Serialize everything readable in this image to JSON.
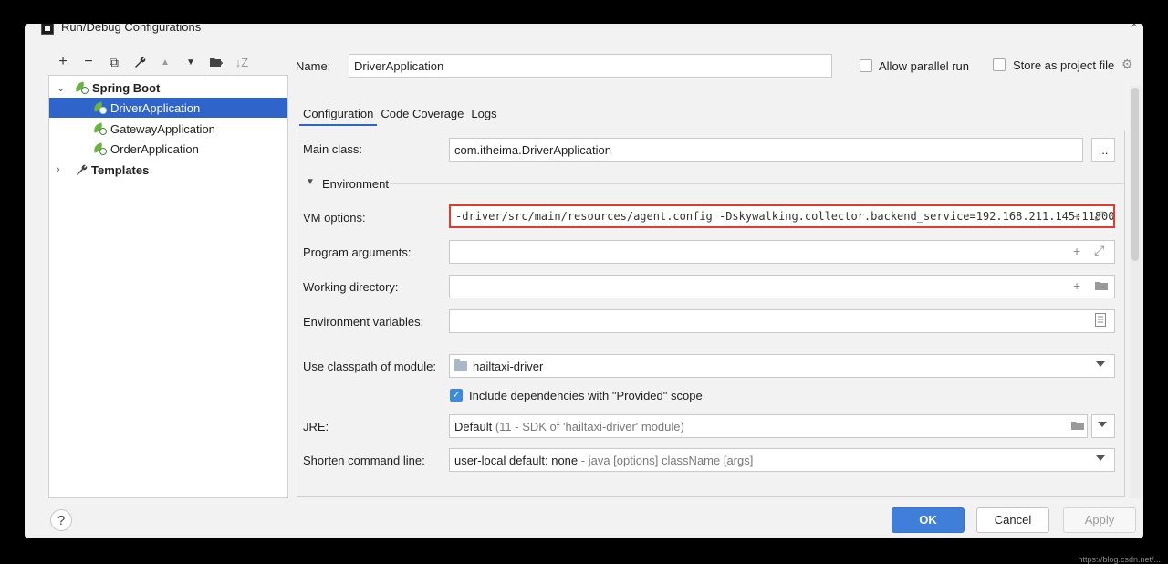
{
  "window": {
    "title": "Run/Debug Configurations",
    "close": "×"
  },
  "toolbar": {
    "add": "+",
    "remove": "−",
    "copy": "⧉",
    "edit": "🔧",
    "up": "▲",
    "down": "▼",
    "folder": "▸",
    "sort": "⇅"
  },
  "tree": {
    "spring_boot": "Spring Boot",
    "items": [
      "DriverApplication",
      "GatewayApplication",
      "OrderApplication"
    ],
    "templates": "Templates"
  },
  "name_row": {
    "label": "Name:",
    "value": "DriverApplication",
    "allow_parallel": "Allow parallel run",
    "store_project": "Store as project file"
  },
  "tabs": [
    "Configuration",
    "Code Coverage",
    "Logs"
  ],
  "form": {
    "main_class_label": "Main class:",
    "main_class_value": "com.itheima.DriverApplication",
    "browse": "...",
    "environment": "Environment",
    "vm_options_label": "VM options:",
    "vm_options_value": "-driver/src/main/resources/agent.config -Dskywalking.collector.backend_service=192.168.211.145:11800",
    "program_args_label": "Program arguments:",
    "working_dir_label": "Working directory:",
    "env_vars_label": "Environment variables:",
    "classpath_label": "Use classpath of module:",
    "classpath_value": "hailtaxi-driver",
    "include_deps": "Include dependencies with \"Provided\" scope",
    "jre_label": "JRE:",
    "jre_value": "Default",
    "jre_hint": "(11 - SDK of 'hailtaxi-driver' module)",
    "shorten_label": "Shorten command line:",
    "shorten_value": "user-local default: none",
    "shorten_hint": "- java [options] className [args]"
  },
  "buttons": {
    "help": "?",
    "ok": "OK",
    "cancel": "Cancel",
    "apply": "Apply"
  },
  "watermark": "https://blog.csdn.net/...",
  "colors": {
    "selection": "#2f65ca",
    "ok": "#3f7fd9",
    "highlight": "#e33a2e",
    "leaf": "#6db33f"
  }
}
